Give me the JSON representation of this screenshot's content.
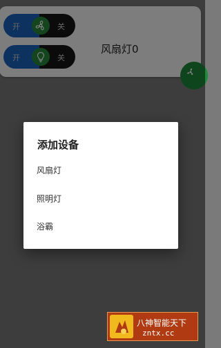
{
  "device_card": {
    "name": "风扇灯0",
    "toggles": [
      {
        "on_label": "开",
        "off_label": "关",
        "icon": "fan-icon"
      },
      {
        "on_label": "开",
        "off_label": "关",
        "icon": "lightbulb-icon"
      }
    ],
    "corner_icon": "fan-icon"
  },
  "dialog": {
    "title": "添加设备",
    "options": [
      "风扇灯",
      "照明灯",
      "浴霸"
    ]
  },
  "watermark": {
    "text_cn": "八神智能天下",
    "text_en": "zntx.cc"
  },
  "colors": {
    "accent_blue": "#1a64c0",
    "accent_green": "#2a8a3c",
    "overlay": "#7a7a7a",
    "watermark_bg": "#b03b12"
  }
}
